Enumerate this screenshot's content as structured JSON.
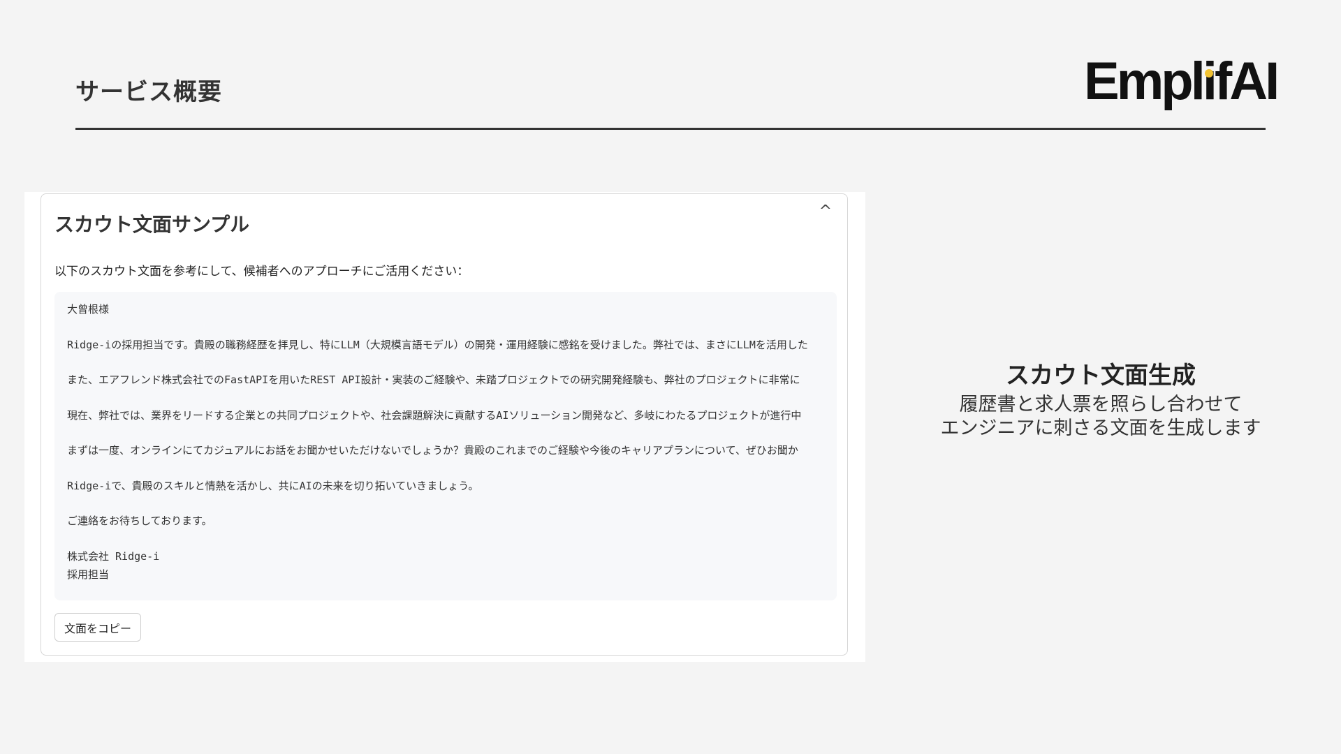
{
  "header": {
    "title": "サービス概要",
    "logo_prefix": "Empl",
    "logo_dot_letter": "i",
    "logo_suffix": "fAI",
    "logo_dot_color": "#f1c232"
  },
  "card": {
    "title": "スカウト文面サンプル",
    "collapse_glyph": "^",
    "intro": "以下のスカウト文面を参考にして、候補者へのアプローチにご活用ください：",
    "lines": [
      "大曾根様",
      "Ridge-iの採用担当です。貴殿の職務経歴を拝見し、特にLLM（大規模言語モデル）の開発・運用経験に感銘を受けました。弊社では、まさにLLMを活用した",
      "また、エアフレンド株式会社でのFastAPIを用いたREST API設計・実装のご経験や、未踏プロジェクトでの研究開発経験も、弊社のプロジェクトに非常に",
      "現在、弊社では、業界をリードする企業との共同プロジェクトや、社会課題解決に貢献するAIソリューション開発など、多岐にわたるプロジェクトが進行中",
      "まずは一度、オンラインにてカジュアルにお話をお聞かせいただけないでしょうか？貴殿のこれまでのご経験や今後のキャリアプランについて、ぜひお聞か",
      "Ridge-iで、貴殿のスキルと情熱を活かし、共にAIの未来を切り拓いていきましょう。",
      "ご連絡をお待ちしております。",
      "株式会社 Ridge-i",
      "採用担当"
    ],
    "copy_button_label": "文面をコピー"
  },
  "side": {
    "title": "スカウト文面生成",
    "desc_line1": "履歴書と求人票を照らし合わせて",
    "desc_line2": "エンジニアに刺さる文面を生成します"
  }
}
